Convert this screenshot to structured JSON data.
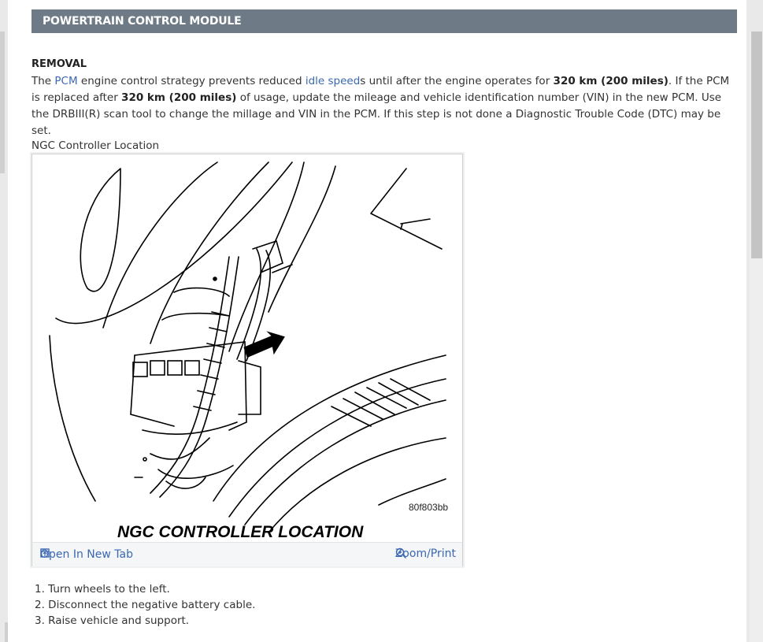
{
  "section": {
    "title": "POWERTRAIN CONTROL MODULE"
  },
  "removal": {
    "heading": "REMOVAL",
    "paragraph": {
      "t1": "The ",
      "link_pcm": "PCM",
      "t2": " engine control strategy prevents reduced ",
      "link_idle": "idle speed",
      "t3": "s until after the engine operates for ",
      "b1": "320 km (200 miles)",
      "t4": ". If the PCM is replaced after ",
      "b2": "320 km (200 miles)",
      "t5": " of usage, update the mileage and vehicle identification number (VIN) in the new PCM. Use the DRBIII(R) scan tool to change the millage and VIN in the PCM. If this step is not done a Diagnostic Trouble Code (DTC) may be set."
    }
  },
  "figure": {
    "caption": "NGC Controller Location",
    "image_code": "80f803bb",
    "image_title": "NGC CONTROLLER LOCATION",
    "open_tab_label": "Open In New Tab",
    "zoom_label": "Zoom/Print",
    "icons": {
      "open": "open-in-new-tab-icon",
      "zoom": "zoom-icon"
    }
  },
  "steps": [
    "1. Turn wheels to the left.",
    "2. Disconnect the negative battery cable.",
    "3. Raise vehicle and support."
  ],
  "colors": {
    "header_bg": "#6e7b87",
    "link": "#3b68b0",
    "accent": "#5b8bd6"
  }
}
